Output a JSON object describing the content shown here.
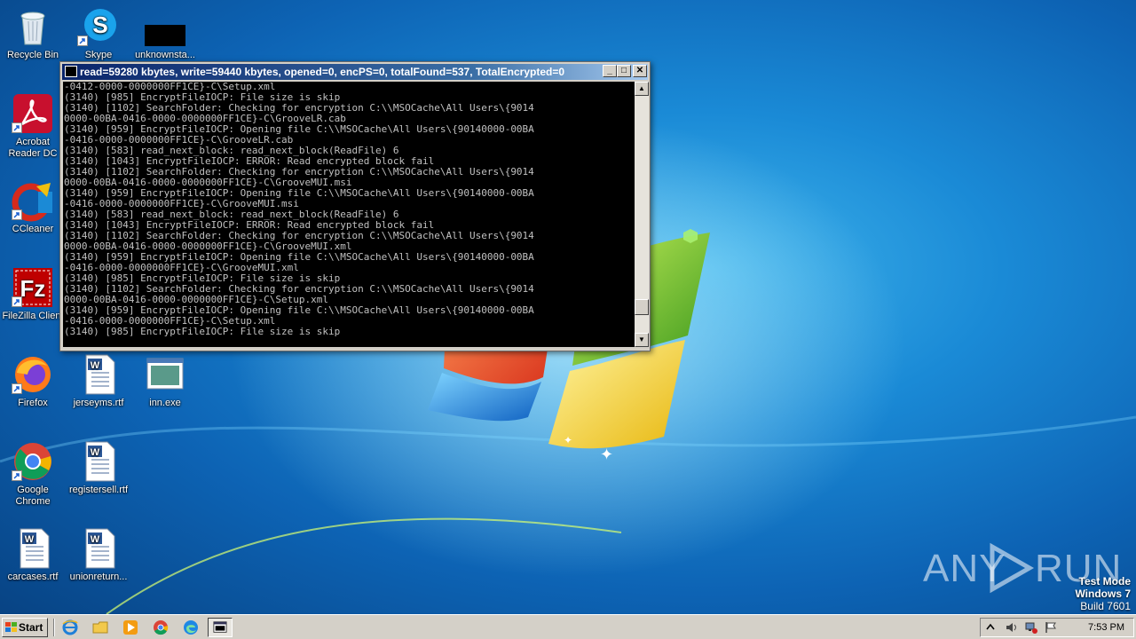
{
  "desktop": {
    "icons": [
      {
        "label": "Recycle Bin",
        "icon": "recycle-bin-icon"
      },
      {
        "label": "Skype",
        "icon": "skype-icon"
      },
      {
        "label": "unknownsta...",
        "icon": "redacted-file-icon"
      },
      {
        "label": "Acrobat Reader DC",
        "icon": "acrobat-icon"
      },
      {
        "label": "CCleaner",
        "icon": "ccleaner-icon"
      },
      {
        "label": "FileZilla Client",
        "icon": "filezilla-icon"
      },
      {
        "label": "Firefox",
        "icon": "firefox-icon"
      },
      {
        "label": "jerseyms.rtf",
        "icon": "word-document-icon"
      },
      {
        "label": "inn.exe",
        "icon": "executable-icon"
      },
      {
        "label": "Google Chrome",
        "icon": "chrome-icon"
      },
      {
        "label": "registersell.rtf",
        "icon": "word-document-icon"
      },
      {
        "label": "carcases.rtf",
        "icon": "word-document-icon"
      },
      {
        "label": "unionreturn...",
        "icon": "word-document-icon"
      }
    ]
  },
  "console": {
    "title": "read=59280 kbytes, write=59440 kbytes, opened=0, encPS=0, totalFound=537, TotalEncrypted=0",
    "buttons": {
      "minimize": "_",
      "maximize": "□",
      "close": "✕"
    },
    "lines": [
      "-0412-0000-0000000FF1CE}-C\\Setup.xml",
      "(3140) [985] EncryptFileIOCP: File size is skip",
      "(3140) [1102] SearchFolder: Checking for encryption C:\\\\MSOCache\\All Users\\{9014",
      "0000-00BA-0416-0000-0000000FF1CE}-C\\GrooveLR.cab",
      "(3140) [959] EncryptFileIOCP: Opening file C:\\\\MSOCache\\All Users\\{90140000-00BA",
      "-0416-0000-0000000FF1CE}-C\\GrooveLR.cab",
      "(3140) [583] read_next_block: read_next_block(ReadFile) 6",
      "(3140) [1043] EncryptFileIOCP: ERROR: Read encrypted block fail",
      "(3140) [1102] SearchFolder: Checking for encryption C:\\\\MSOCache\\All Users\\{9014",
      "0000-00BA-0416-0000-0000000FF1CE}-C\\GrooveMUI.msi",
      "(3140) [959] EncryptFileIOCP: Opening file C:\\\\MSOCache\\All Users\\{90140000-00BA",
      "-0416-0000-0000000FF1CE}-C\\GrooveMUI.msi",
      "(3140) [583] read_next_block: read_next_block(ReadFile) 6",
      "(3140) [1043] EncryptFileIOCP: ERROR: Read encrypted block fail",
      "(3140) [1102] SearchFolder: Checking for encryption C:\\\\MSOCache\\All Users\\{9014",
      "0000-00BA-0416-0000-0000000FF1CE}-C\\GrooveMUI.xml",
      "(3140) [959] EncryptFileIOCP: Opening file C:\\\\MSOCache\\All Users\\{90140000-00BA",
      "-0416-0000-0000000FF1CE}-C\\GrooveMUI.xml",
      "(3140) [985] EncryptFileIOCP: File size is skip",
      "(3140) [1102] SearchFolder: Checking for encryption C:\\\\MSOCache\\All Users\\{9014",
      "0000-00BA-0416-0000-0000000FF1CE}-C\\Setup.xml",
      "(3140) [959] EncryptFileIOCP: Opening file C:\\\\MSOCache\\All Users\\{90140000-00BA",
      "-0416-0000-0000000FF1CE}-C\\Setup.xml",
      "(3140) [985] EncryptFileIOCP: File size is skip"
    ],
    "scroll_position": 0.92
  },
  "watermark": {
    "left": "ANY",
    "right": "RUN"
  },
  "test_mode": {
    "line1": "Test Mode",
    "line2": "Windows 7",
    "line3": "Build 7601"
  },
  "taskbar": {
    "start_label": "Start",
    "pinned": [
      "internet-explorer-icon",
      "file-explorer-icon",
      "media-player-icon",
      "chrome-icon",
      "edge-icon",
      "console-window-icon"
    ],
    "clock": "7:53 PM"
  },
  "colors": {
    "console_bg": "#000000",
    "console_text": "#c0c0c0",
    "titlebar": "#0a246a"
  }
}
